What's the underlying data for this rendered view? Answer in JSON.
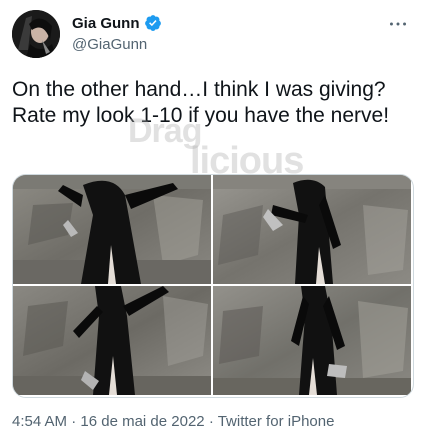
{
  "tweet": {
    "author": {
      "display_name": "Gia Gunn",
      "handle": "@GiaGunn",
      "verified": true,
      "avatar_icon": "profile-photo"
    },
    "more_icon": "ellipsis-icon",
    "text": "On the other hand…I think I was giving? Rate my look 1-10 if you have the nerve!",
    "watermark": {
      "line1": "Drag",
      "line2": "licious"
    },
    "media": [
      {
        "label": "photo-1"
      },
      {
        "label": "photo-2"
      },
      {
        "label": "photo-3"
      },
      {
        "label": "photo-4"
      }
    ],
    "meta": {
      "time": "4:54 AM",
      "date": "16 de mai de 2022",
      "separator": " · ",
      "source": "Twitter for iPhone"
    }
  },
  "colors": {
    "verified_blue": "#1d9bf0",
    "text_primary": "#0f1419",
    "text_secondary": "#536471",
    "border": "#cfd9de"
  }
}
